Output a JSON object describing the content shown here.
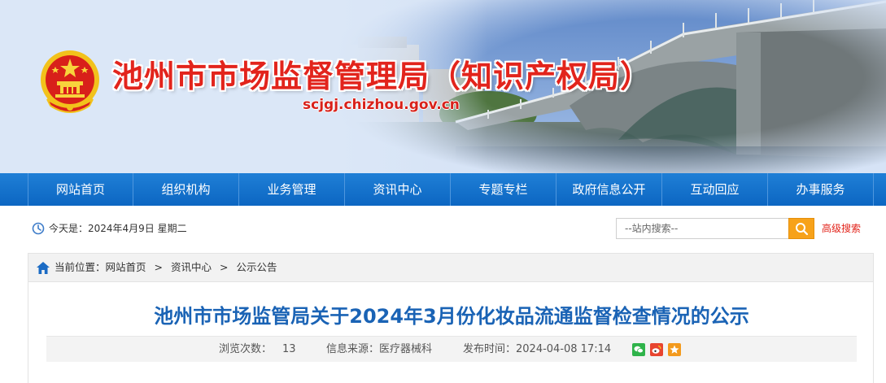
{
  "header": {
    "title": "池州市市场监督管理局（知识产权局）",
    "domain": "scjgj.chizhou.gov.cn",
    "emblem_icon": "national-emblem-icon"
  },
  "nav": {
    "items": [
      {
        "label": "网站首页"
      },
      {
        "label": "组织机构"
      },
      {
        "label": "业务管理"
      },
      {
        "label": "资讯中心"
      },
      {
        "label": "专题专栏"
      },
      {
        "label": "政府信息公开"
      },
      {
        "label": "互动回应"
      },
      {
        "label": "办事服务"
      }
    ]
  },
  "infobar": {
    "today": "今天是：2024年4月9日 星期二",
    "search_placeholder": "--站内搜索--",
    "advanced_search": "高级搜索"
  },
  "breadcrumb": {
    "label": "当前位置：",
    "items": [
      "网站首页",
      "资讯中心",
      "公示公告"
    ],
    "separator": ">"
  },
  "article": {
    "title": "池州市市场监管局关于2024年3月份化妆品流通监督检查情况的公示",
    "views_label": "浏览次数：",
    "views": "13",
    "source": "信息来源：医疗器械科",
    "published": "发布时间：2024-04-08 17:14",
    "share_icons": [
      "wechat-icon",
      "weibo-icon",
      "favorite-icon"
    ]
  },
  "colors": {
    "brand_red": "#e2241c",
    "nav_blue": "#0c66c2",
    "title_blue": "#1a63b5",
    "search_orange": "#f7a21a"
  }
}
